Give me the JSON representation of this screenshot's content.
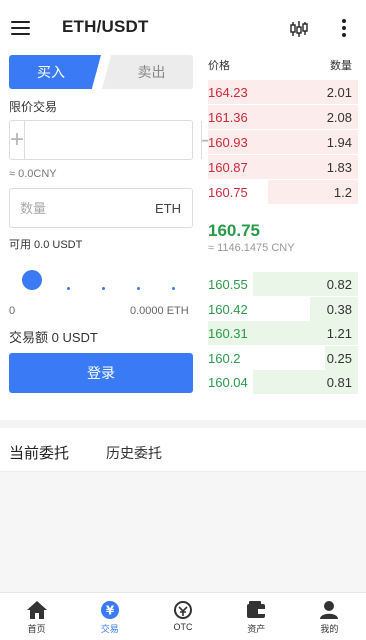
{
  "header": {
    "title": "ETH/USDT",
    "icons": [
      "menu-icon",
      "kline-icon",
      "more-icon"
    ]
  },
  "trade": {
    "buy_tab": "买入",
    "sell_tab": "卖出",
    "order_type": "限价交易",
    "price_value": "",
    "plus": "+",
    "minus": "—",
    "cny_approx": "≈ 0.0CNY",
    "quantity_placeholder": "数量",
    "quantity_unit": "ETH",
    "available": "可用 0.0 USDT",
    "slider_fraction": 0,
    "range_min": "0",
    "range_max": "0.0000 ETH",
    "trade_amount": "交易额 0 USDT",
    "login_button": "登录"
  },
  "order_book": {
    "price_header": "价格",
    "qty_header": "数量",
    "asks": [
      {
        "price": "164.23",
        "qty": "2.01",
        "depth": 1.0
      },
      {
        "price": "161.36",
        "qty": "2.08",
        "depth": 1.0
      },
      {
        "price": "160.93",
        "qty": "1.94",
        "depth": 1.0
      },
      {
        "price": "160.87",
        "qty": "1.83",
        "depth": 1.0
      },
      {
        "price": "160.75",
        "qty": "1.2",
        "depth": 0.6
      }
    ],
    "last_price": "160.75",
    "last_price_cny": "≈ 1146.1475 CNY",
    "bids": [
      {
        "price": "160.55",
        "qty": "0.82",
        "depth": 0.7
      },
      {
        "price": "160.42",
        "qty": "0.38",
        "depth": 0.32
      },
      {
        "price": "160.31",
        "qty": "1.21",
        "depth": 1.0
      },
      {
        "price": "160.2",
        "qty": "0.25",
        "depth": 0.22
      },
      {
        "price": "160.04",
        "qty": "0.81",
        "depth": 0.7
      }
    ]
  },
  "orders": {
    "current_tab": "当前委托",
    "history_tab": "历史委托"
  },
  "bottom_nav": [
    {
      "label": "首页",
      "icon": "home-icon"
    },
    {
      "label": "交易",
      "icon": "yen-icon",
      "active": true
    },
    {
      "label": "OTC",
      "icon": "otc-icon"
    },
    {
      "label": "资产",
      "icon": "wallet-icon"
    },
    {
      "label": "我的",
      "icon": "user-icon"
    }
  ],
  "colors": {
    "accent": "#3a7bf5",
    "ask": "#c92a3c",
    "bid": "#2a9a4a"
  }
}
